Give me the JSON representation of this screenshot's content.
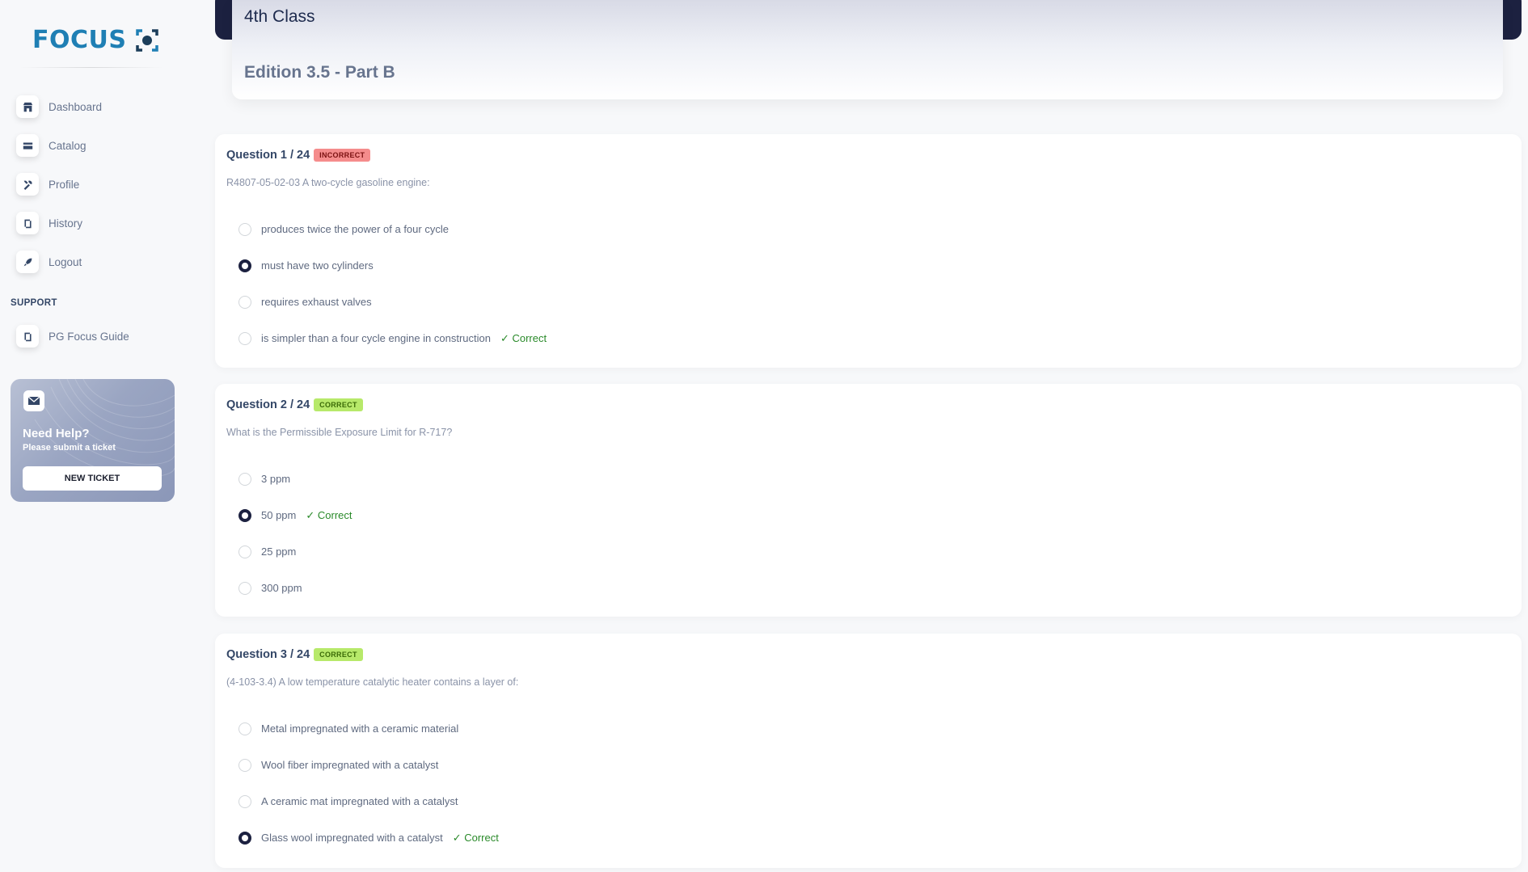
{
  "brand": {
    "name": "FOCUS"
  },
  "nav": [
    {
      "label": "Dashboard",
      "icon": "shop-icon"
    },
    {
      "label": "Catalog",
      "icon": "credit-card-icon"
    },
    {
      "label": "Profile",
      "icon": "tools-icon"
    },
    {
      "label": "History",
      "icon": "document-icon"
    },
    {
      "label": "Logout",
      "icon": "rocket-icon"
    }
  ],
  "support": {
    "title": "SUPPORT",
    "items": [
      {
        "label": "PG Focus Guide",
        "icon": "document-icon"
      }
    ]
  },
  "help": {
    "title": "Need Help?",
    "subtitle": "Please submit a ticket",
    "button": "NEW TICKET"
  },
  "header": {
    "title": "4th Class",
    "subtitle": "Edition 3.5 - Part B"
  },
  "questions": [
    {
      "title": "Question 1 / 24",
      "status": "INCORRECT",
      "text": "R4807-05-02-03 A two-cycle gasoline engine:",
      "options": [
        {
          "label": "produces twice the power of a four cycle",
          "selected": false,
          "correct": false
        },
        {
          "label": "must have two cylinders",
          "selected": true,
          "correct": false
        },
        {
          "label": "requires exhaust valves",
          "selected": false,
          "correct": false
        },
        {
          "label": "is simpler than a four cycle engine in construction",
          "selected": false,
          "correct": true
        }
      ]
    },
    {
      "title": "Question 2 / 24",
      "status": "CORRECT",
      "text": "What is the Permissible Exposure Limit for R-717?",
      "options": [
        {
          "label": "3 ppm",
          "selected": false,
          "correct": false
        },
        {
          "label": "50 ppm",
          "selected": true,
          "correct": true
        },
        {
          "label": "25 ppm",
          "selected": false,
          "correct": false
        },
        {
          "label": "300 ppm",
          "selected": false,
          "correct": false
        }
      ]
    },
    {
      "title": "Question 3 / 24",
      "status": "CORRECT",
      "text": "(4-103-3.4) A low temperature catalytic heater contains a layer of:",
      "options": [
        {
          "label": "Metal impregnated with a ceramic material",
          "selected": false,
          "correct": false
        },
        {
          "label": "Wool fiber impregnated with a catalyst",
          "selected": false,
          "correct": false
        },
        {
          "label": "A ceramic mat impregnated with a catalyst",
          "selected": false,
          "correct": false
        },
        {
          "label": "Glass wool impregnated with a catalyst",
          "selected": true,
          "correct": true
        }
      ]
    }
  ],
  "correct_text": "✓ Correct",
  "colors": {
    "brand": "#1f7fb4",
    "navy": "#1c2140",
    "incorrect": "#f58c8c",
    "correct": "#b7e96a"
  }
}
